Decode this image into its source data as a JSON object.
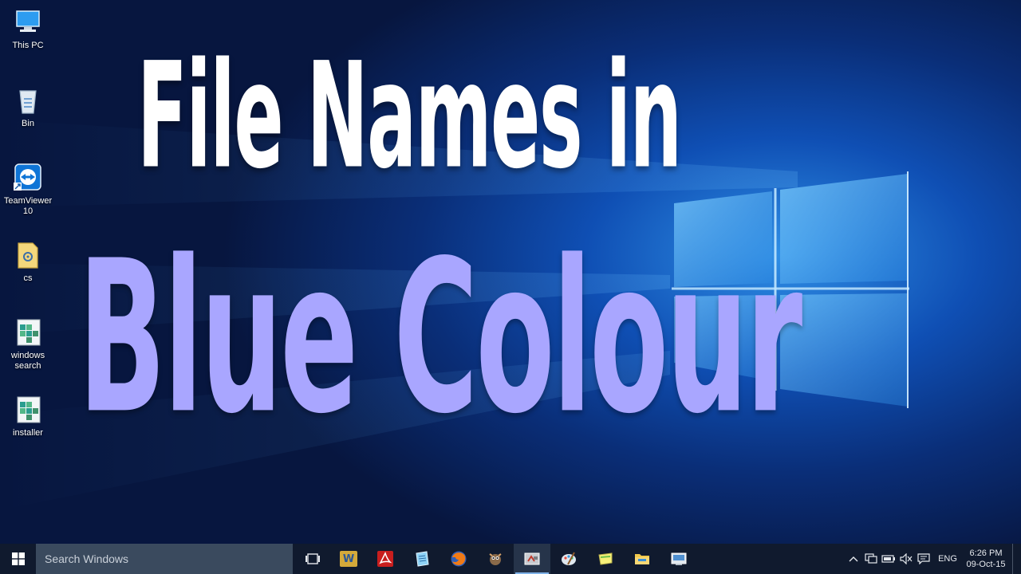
{
  "desktop": {
    "icons": [
      {
        "label": "This PC",
        "icon": "computer-icon"
      },
      {
        "label": "Bin",
        "icon": "recycle-bin-icon"
      },
      {
        "label": "TeamViewer\n10",
        "icon": "teamviewer-icon"
      },
      {
        "label": "cs",
        "icon": "folder-icon"
      },
      {
        "label": "windows\nsearch",
        "icon": "registry-icon"
      },
      {
        "label": "installer",
        "icon": "registry-icon"
      }
    ]
  },
  "overlay": {
    "line1": "File Names in",
    "line2": "Blue Colour",
    "line1_color": "#ffffff",
    "line2_color": "#a9a6ff"
  },
  "taskbar": {
    "search_placeholder": "Search Windows",
    "apps": [
      {
        "name": "word",
        "icon": "word-icon"
      },
      {
        "name": "acrobat",
        "icon": "acrobat-icon"
      },
      {
        "name": "notepad",
        "icon": "notepad-icon"
      },
      {
        "name": "firefox",
        "icon": "firefox-icon"
      },
      {
        "name": "gimp",
        "icon": "gimp-icon"
      },
      {
        "name": "recorder",
        "icon": "screen-recorder-icon",
        "active": true
      },
      {
        "name": "paint",
        "icon": "paint-icon"
      },
      {
        "name": "sticky",
        "icon": "notes-icon"
      },
      {
        "name": "explorer",
        "icon": "file-explorer-icon"
      },
      {
        "name": "control-panel",
        "icon": "control-panel-icon"
      }
    ],
    "tray": {
      "language": "ENG",
      "time": "6:26 PM",
      "date": "09-Oct-15"
    }
  },
  "colors": {
    "taskbar_bg": "#101a2e",
    "search_bg": "#3a4a5e",
    "accent": "#7fb2e8"
  }
}
